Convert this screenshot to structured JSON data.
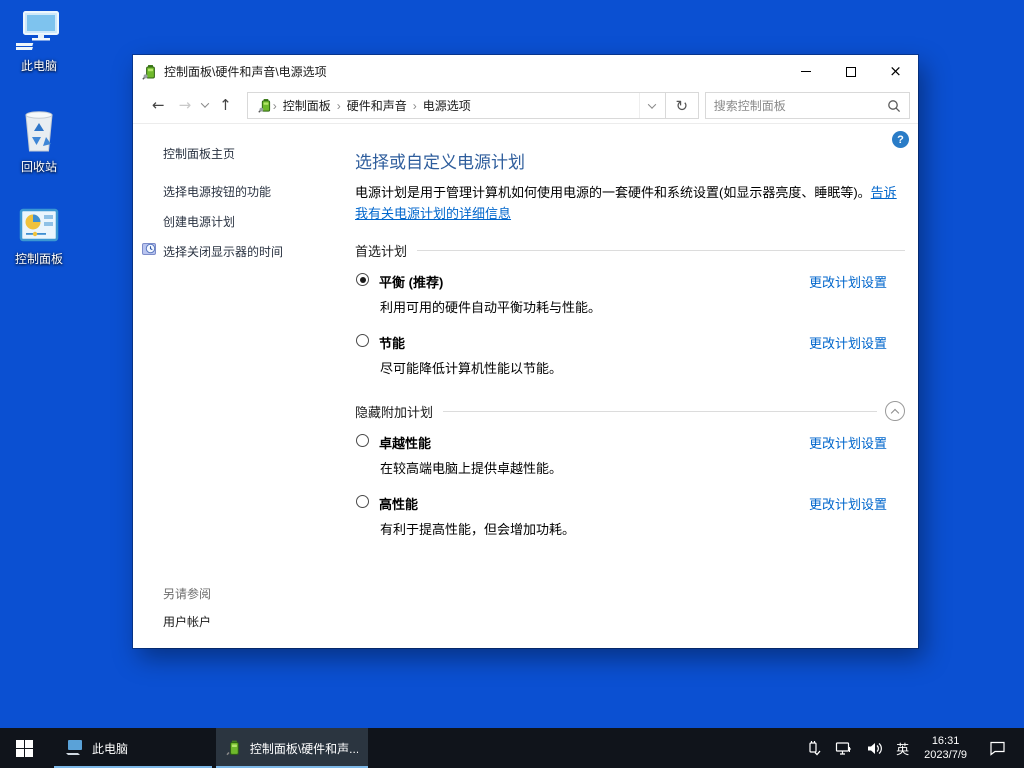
{
  "desktop": {
    "icons": [
      {
        "label": "此电脑"
      },
      {
        "label": "回收站"
      },
      {
        "label": "控制面板"
      }
    ]
  },
  "window": {
    "title": "控制面板\\硬件和声音\\电源选项",
    "nav": {
      "breadcrumb": [
        "控制面板",
        "硬件和声音",
        "电源选项"
      ],
      "search_placeholder": "搜索控制面板"
    },
    "sidebar": {
      "items": [
        "控制面板主页",
        "选择电源按钮的功能",
        "创建电源计划",
        "选择关闭显示器的时间"
      ],
      "see_also_header": "另请参阅",
      "see_also_items": [
        "用户帐户"
      ]
    },
    "main": {
      "title": "选择或自定义电源计划",
      "description": "电源计划是用于管理计算机如何使用电源的一套硬件和系统设置(如显示器亮度、睡眠等)。",
      "description_link": "告诉我有关电源计划的详细信息",
      "section_preferred": "首选计划",
      "section_hidden": "隐藏附加计划",
      "plans": [
        {
          "name": "平衡 (推荐)",
          "description": "利用可用的硬件自动平衡功耗与性能。",
          "action": "更改计划设置",
          "selected": true
        },
        {
          "name": "节能",
          "description": "尽可能降低计算机性能以节能。",
          "action": "更改计划设置",
          "selected": false
        },
        {
          "name": "卓越性能",
          "description": "在较高端电脑上提供卓越性能。",
          "action": "更改计划设置",
          "selected": false
        },
        {
          "name": "高性能",
          "description": "有利于提高性能，但会增加功耗。",
          "action": "更改计划设置",
          "selected": false
        }
      ]
    }
  },
  "taskbar": {
    "tasks": [
      {
        "label": "此电脑"
      },
      {
        "label": "控制面板\\硬件和声..."
      }
    ],
    "tray": {
      "language": "英",
      "time": "16:31",
      "date": "2023/7/9"
    }
  },
  "colors": {
    "desktop_bg": "#0b50d2",
    "taskbar_bg": "#10141b",
    "accent_link": "#0066cc",
    "heading": "#2e5d9c",
    "task_underline": "#7db8e8"
  }
}
